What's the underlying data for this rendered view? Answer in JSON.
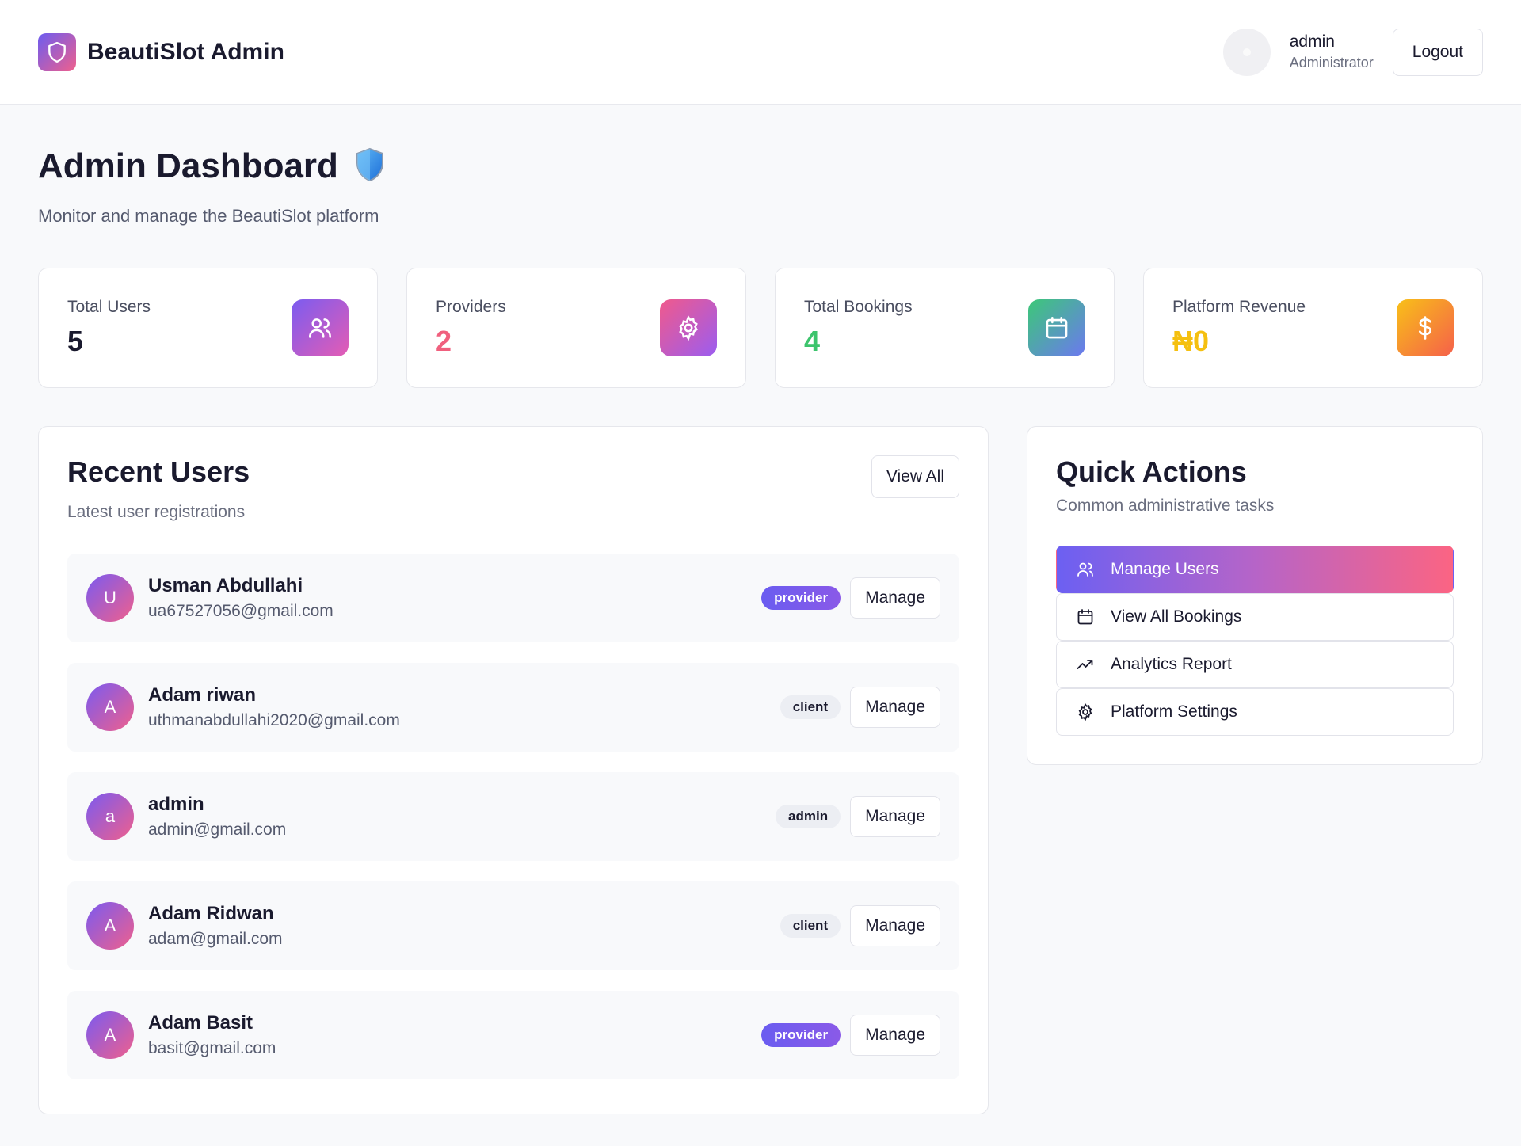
{
  "header": {
    "brand": "BeautiSlot Admin",
    "user_name": "admin",
    "user_role": "Administrator",
    "logout_label": "Logout"
  },
  "page": {
    "title": "Admin Dashboard",
    "subtitle": "Monitor and manage the BeautiSlot platform"
  },
  "stats": [
    {
      "label": "Total Users",
      "value": "5",
      "color": "#1a1a2e",
      "icon": "users-icon"
    },
    {
      "label": "Providers",
      "value": "2",
      "color": "#f0607e",
      "icon": "gear-icon"
    },
    {
      "label": "Total Bookings",
      "value": "4",
      "color": "#3cc46c",
      "icon": "calendar-icon"
    },
    {
      "label": "Platform Revenue",
      "value": "₦0",
      "color": "#f5c010",
      "icon": "dollar-icon"
    }
  ],
  "recent": {
    "title": "Recent Users",
    "subtitle": "Latest user registrations",
    "view_all_label": "View All",
    "manage_label": "Manage",
    "users": [
      {
        "initial": "U",
        "name": "Usman Abdullahi",
        "email": "ua67527056@gmail.com",
        "role": "provider"
      },
      {
        "initial": "A",
        "name": "Adam riwan",
        "email": "uthmanabdullahi2020@gmail.com",
        "role": "client"
      },
      {
        "initial": "a",
        "name": "admin",
        "email": "admin@gmail.com",
        "role": "admin"
      },
      {
        "initial": "A",
        "name": "Adam Ridwan",
        "email": "adam@gmail.com",
        "role": "client"
      },
      {
        "initial": "A",
        "name": "Adam Basit",
        "email": "basit@gmail.com",
        "role": "provider"
      }
    ]
  },
  "quick": {
    "title": "Quick Actions",
    "subtitle": "Common administrative tasks",
    "actions": [
      {
        "label": "Manage Users",
        "icon": "users-icon"
      },
      {
        "label": "View All Bookings",
        "icon": "calendar-icon"
      },
      {
        "label": "Analytics Report",
        "icon": "trending-up-icon"
      },
      {
        "label": "Platform Settings",
        "icon": "gear-icon"
      }
    ]
  }
}
